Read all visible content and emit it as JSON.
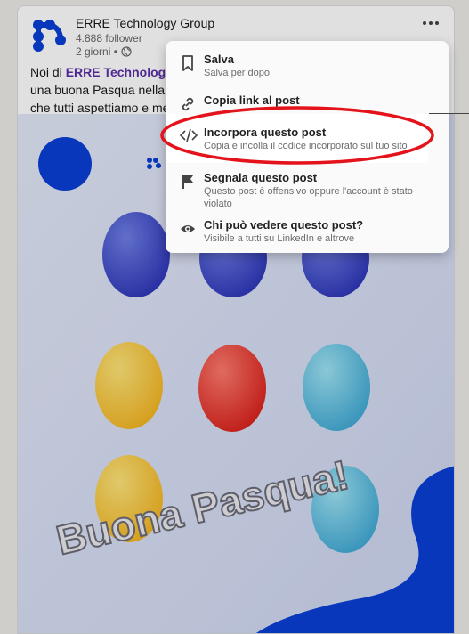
{
  "post": {
    "company_name": "ERRE Technology Group",
    "followers": "4.888 follower",
    "age": "2 giorni •",
    "text": {
      "line1_prefix": "Noi di ",
      "mention": "ERRE Technology Gr",
      "line2": "una buona Pasqua nella spe",
      "line3": "che tutti aspettiamo e merit"
    },
    "image_caption": "Buona Pasqua!"
  },
  "menu": {
    "items": [
      {
        "label": "Salva",
        "sublabel": "Salva per dopo",
        "icon": "bookmark-icon"
      },
      {
        "label": "Copia link al post",
        "icon": "link-icon"
      },
      {
        "label": "Incorpora questo post",
        "sublabel": "Copia e incolla il codice incorporato sul tuo sito",
        "icon": "code-icon"
      },
      {
        "label": "Segnala questo post",
        "sublabel": "Questo post è offensivo oppure l'account è stato",
        "sublabel2": "violato",
        "icon": "flag-icon"
      },
      {
        "label": "Chi può vedere questo post?",
        "sublabel": "Visibile a tutti su LinkedIn e altrove",
        "icon": "eye-icon"
      }
    ]
  },
  "colors": {
    "brand_blue": "#0a3fd6",
    "mention_purple": "#5b2fa8",
    "annotation_red": "#e3121b"
  }
}
